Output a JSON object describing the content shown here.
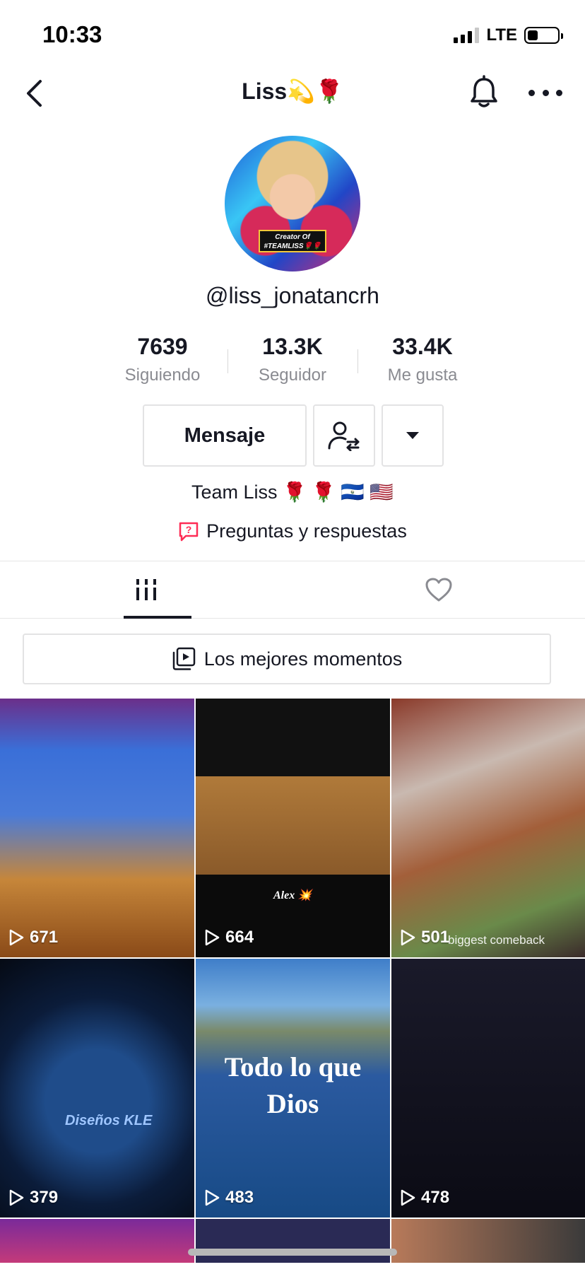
{
  "status_bar": {
    "time": "10:33",
    "network": "LTE",
    "battery_level": 0.35
  },
  "header": {
    "title": "Liss💫🌹",
    "icons": [
      "back-chevron-icon",
      "bell-icon",
      "more-dots-icon"
    ]
  },
  "profile": {
    "avatar_text": "Creator Of #TEAMLISS🌹🌹",
    "username": "@liss_jonatancrh",
    "stats": [
      {
        "count": "7639",
        "label": "Siguiendo"
      },
      {
        "count": "13.3K",
        "label": "Seguidor"
      },
      {
        "count": "33.4K",
        "label": "Me gusta"
      }
    ],
    "message_label": "Mensaje",
    "bio": "Team Liss 🌹 🌹 🇸🇻 🇺🇸",
    "qa_label": "Preguntas y respuestas"
  },
  "tabs": {
    "active": "videos",
    "items": [
      "videos-grid-icon",
      "liked-heart-icon"
    ]
  },
  "highlights_label": "Los mejores momentos",
  "videos": [
    {
      "views": "671",
      "caption": ""
    },
    {
      "views": "664",
      "caption": "Alex 💥"
    },
    {
      "views": "501",
      "caption": "biggest comeback"
    },
    {
      "views": "379",
      "caption": "Diseños KLE"
    },
    {
      "views": "483",
      "caption": "Todo lo que Dios"
    },
    {
      "views": "478",
      "caption": ""
    }
  ],
  "colors": {
    "text": "#161823",
    "secondary_text": "#8a8b91",
    "border": "#e3e3e4",
    "qa_accent": "#fe2c55"
  }
}
